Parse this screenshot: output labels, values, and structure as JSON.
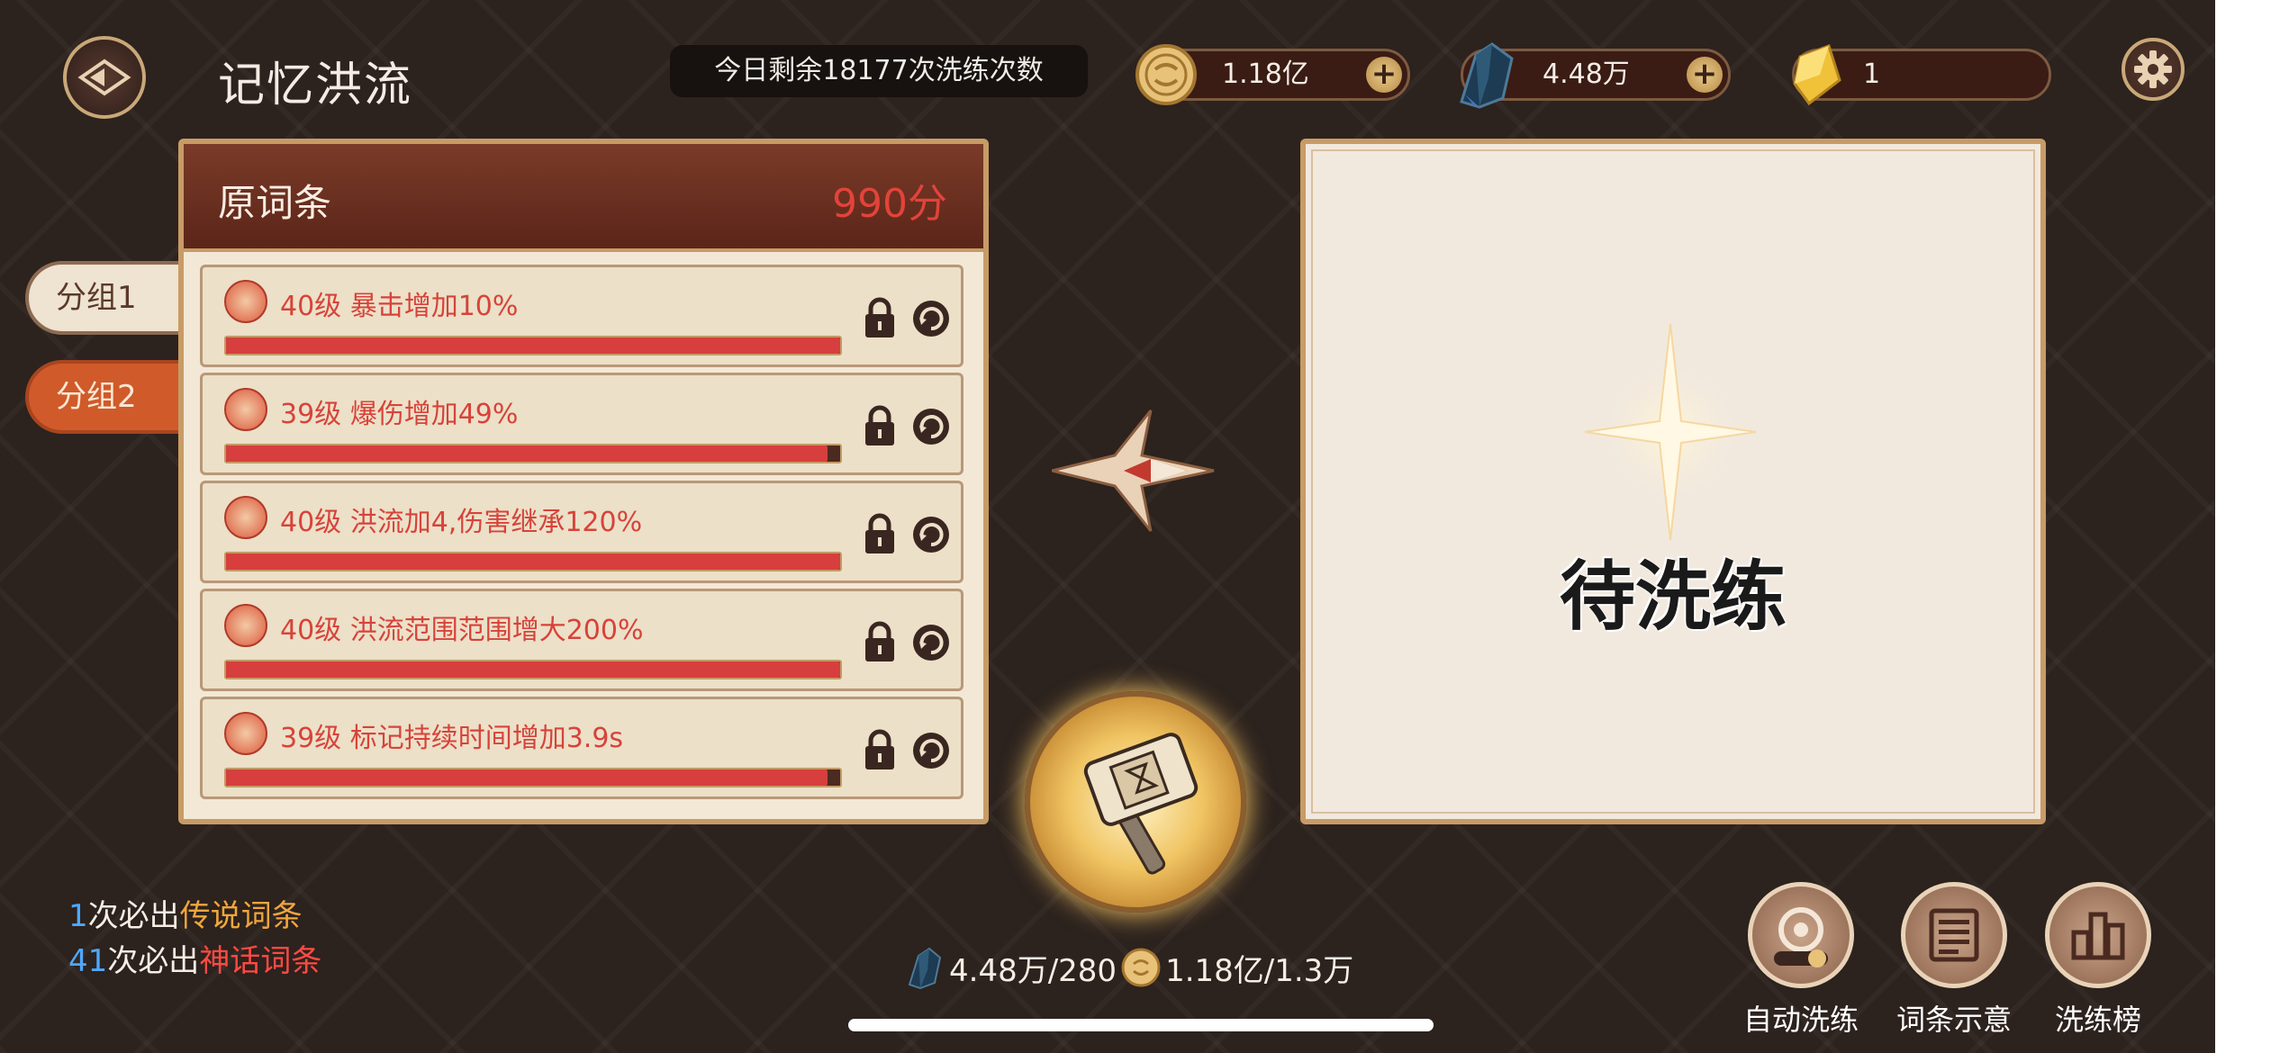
{
  "header": {
    "title": "记忆洪流",
    "remaining_text": "今日剩余18177次洗练次数"
  },
  "currencies": [
    {
      "icon": "gold-coin-icon",
      "value": "1.18亿"
    },
    {
      "icon": "dark-crystal-icon",
      "value": "4.48万"
    },
    {
      "icon": "gold-gem-icon",
      "value": "1"
    }
  ],
  "groups": [
    "分组1",
    "分组2"
  ],
  "original": {
    "title": "原词条",
    "score": "990分",
    "stats": [
      {
        "text": "40级 暴击增加10%",
        "progress": 1.0
      },
      {
        "text": "39级 爆伤增加49%",
        "progress": 0.98
      },
      {
        "text": "40级 洪流加4,伤害继承120%",
        "progress": 1.0
      },
      {
        "text": "40级 洪流范围范围增大200%",
        "progress": 1.0
      },
      {
        "text": "39级 标记持续时间增加3.9s",
        "progress": 0.98
      }
    ]
  },
  "result": {
    "pending_text": "待洗练"
  },
  "guarantees": {
    "legend_count": "1",
    "legend_prefix": "次必出",
    "legend_label": "传说词条",
    "myth_count": "41",
    "myth_prefix": "次必出",
    "myth_label": "神话词条"
  },
  "cost": {
    "crystal": "4.48万/280",
    "gold": "1.18亿/1.3万"
  },
  "buttons": {
    "auto_refine": "自动洗练",
    "stat_preview": "词条示意",
    "ranking": "洗练榜"
  },
  "colors": {
    "accent_red": "#d7433a",
    "legend_orange": "#f0a63d",
    "myth_red": "#ff4a42",
    "count_blue": "#4ea8ff"
  }
}
